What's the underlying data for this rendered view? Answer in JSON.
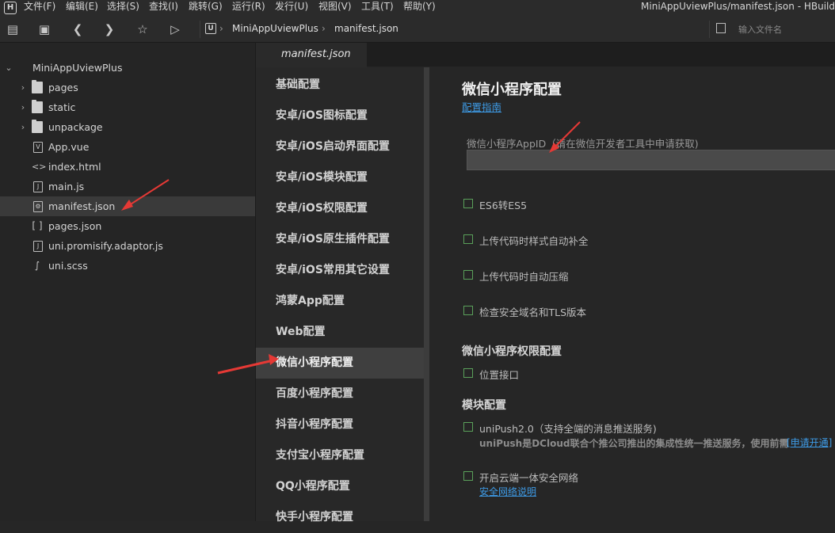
{
  "menubar": {
    "logo": "H",
    "items": [
      "文件(F)",
      "编辑(E)",
      "选择(S)",
      "查找(I)",
      "跳转(G)",
      "运行(R)",
      "发行(U)",
      "视图(V)",
      "工具(T)",
      "帮助(Y)"
    ],
    "window_title": "MiniAppUviewPlus/manifest.json - HBuild"
  },
  "toolbar": {
    "breadcrumb": [
      "MiniAppUviewPlus",
      "manifest.json"
    ],
    "search_placeholder": "输入文件名"
  },
  "sidebar": {
    "project": "MiniAppUviewPlus",
    "items": [
      {
        "label": "pages",
        "type": "folder"
      },
      {
        "label": "static",
        "type": "folder"
      },
      {
        "label": "unpackage",
        "type": "folder"
      },
      {
        "label": "App.vue",
        "type": "vue"
      },
      {
        "label": "index.html",
        "type": "html"
      },
      {
        "label": "main.js",
        "type": "js"
      },
      {
        "label": "manifest.json",
        "type": "manifest",
        "selected": true
      },
      {
        "label": "pages.json",
        "type": "json"
      },
      {
        "label": "uni.promisify.adaptor.js",
        "type": "js"
      },
      {
        "label": "uni.scss",
        "type": "scss"
      }
    ]
  },
  "editor": {
    "tab": "manifest.json",
    "nav": [
      "基础配置",
      "安卓/iOS图标配置",
      "安卓/iOS启动界面配置",
      "安卓/iOS模块配置",
      "安卓/iOS权限配置",
      "安卓/iOS原生插件配置",
      "安卓/iOS常用其它设置",
      "鸿蒙App配置",
      "Web配置",
      "微信小程序配置",
      "百度小程序配置",
      "抖音小程序配置",
      "支付宝小程序配置",
      "QQ小程序配置",
      "快手小程序配置"
    ],
    "active_nav": "微信小程序配置"
  },
  "content": {
    "title": "微信小程序配置",
    "guide_link": "配置指南",
    "appid_label": "微信小程序AppID（请在微信开发者工具中申请获取)",
    "appid_value": "",
    "options": [
      "ES6转ES5",
      "上传代码时样式自动补全",
      "上传代码时自动压缩",
      "检查安全域名和TLS版本"
    ],
    "permission_heading": "微信小程序权限配置",
    "permission_option": "位置接口",
    "module_heading": "模块配置",
    "unipush_label": "uniPush2.0（支持全端的消息推送服务)",
    "unipush_desc": "uniPush是DCloud联合个推公司推出的集成性统一推送服务，使用前需",
    "unipush_link": "[申请开通]",
    "security_label": "开启云端一体安全网络",
    "security_link": "安全网络说明"
  },
  "colors": {
    "accent_link": "#3e9be6",
    "checkbox_border": "#5aa05a",
    "arrow": "#e53935"
  }
}
